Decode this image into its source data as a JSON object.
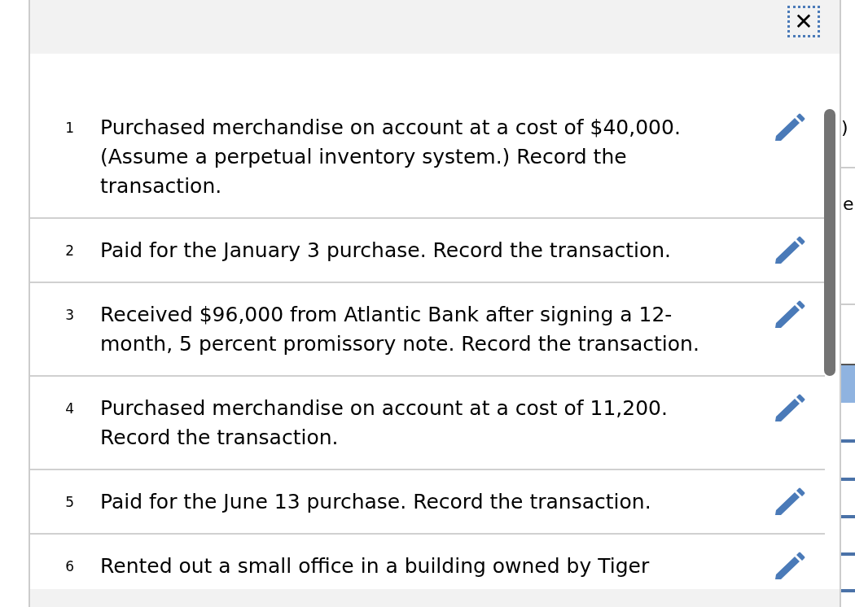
{
  "close_button": {
    "label": "✕",
    "focused": true
  },
  "items": [
    {
      "number": "1",
      "text": "Purchased merchandise on account at a cost of $40,000. (Assume a perpetual inventory system.) Record the transaction."
    },
    {
      "number": "2",
      "text": "Paid for the January 3 purchase. Record the transaction."
    },
    {
      "number": "3",
      "text": "Received $96,000 from Atlantic Bank after signing a 12-month, 5 percent promissory note. Record the transaction."
    },
    {
      "number": "4",
      "text": "Purchased merchandise on account at a cost of 11,200. Record the transaction."
    },
    {
      "number": "5",
      "text": "Paid for the June 13 purchase. Record the transaction."
    },
    {
      "number": "6",
      "text": "Rented out a small office in a building owned by Tiger"
    }
  ],
  "background_fragments": [
    ")",
    "e"
  ]
}
